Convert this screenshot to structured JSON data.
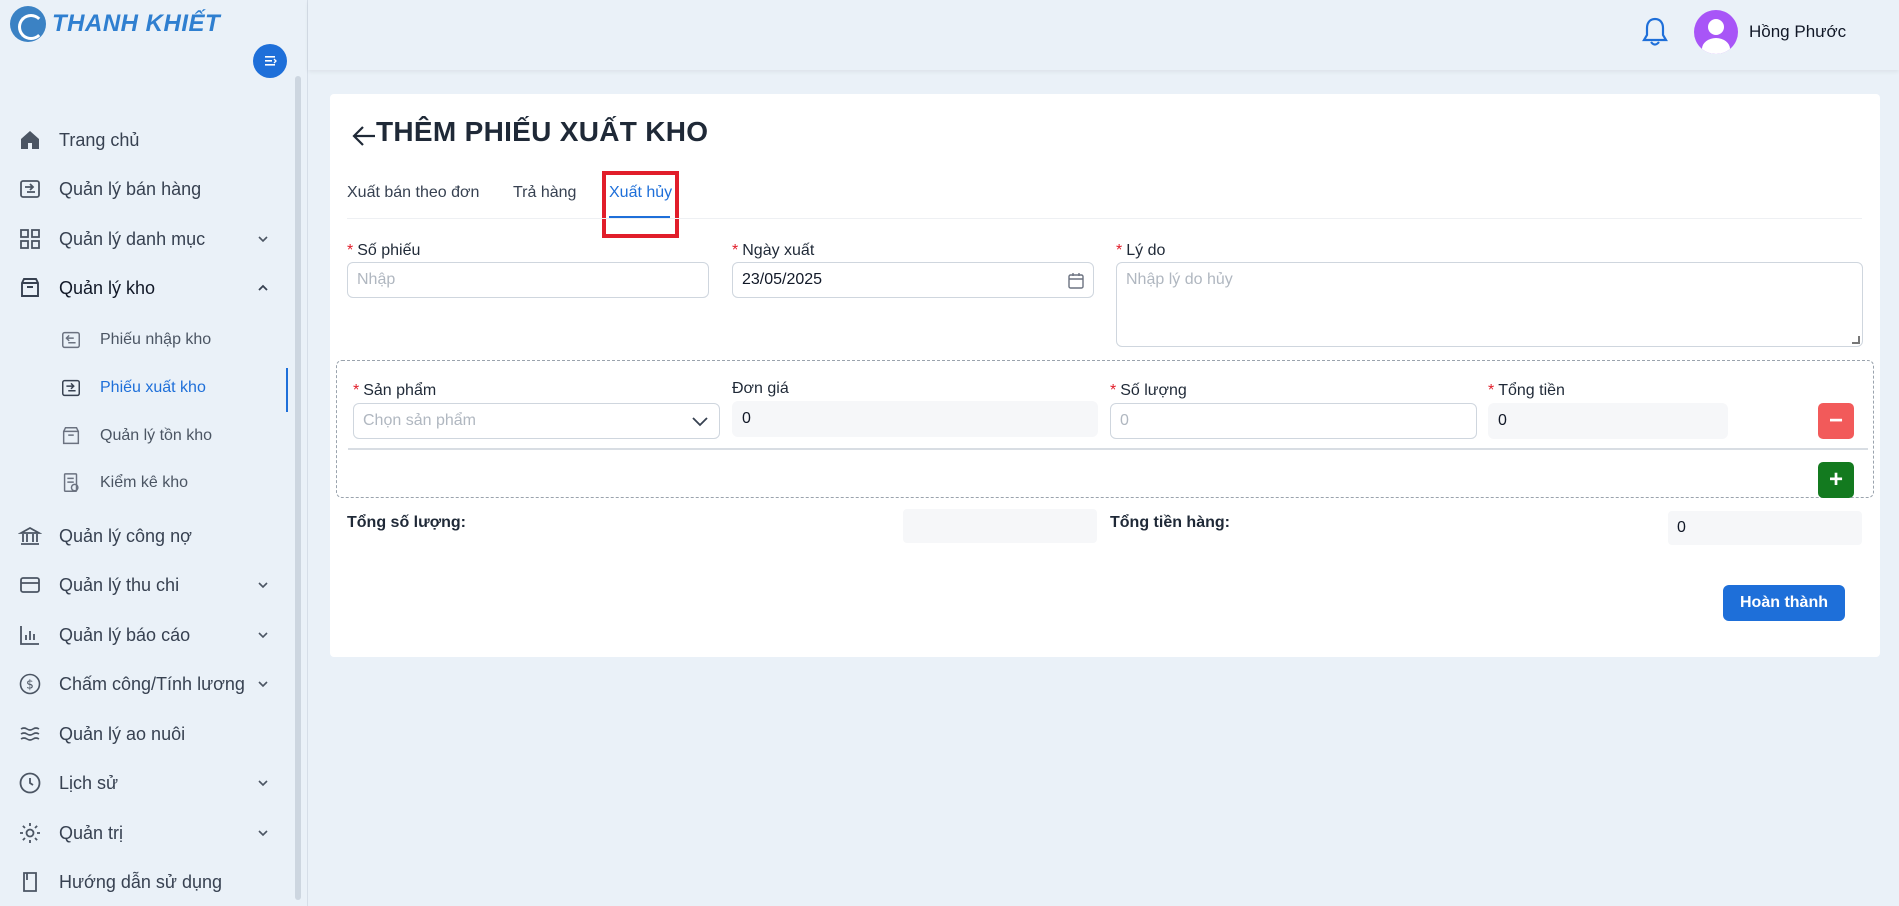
{
  "brand": {
    "name": "THANH KHIẾT"
  },
  "user": {
    "name": "Hồng Phước"
  },
  "sidebar": {
    "items": [
      {
        "label": "Trang chủ",
        "icon": "home-icon"
      },
      {
        "label": "Quản lý bán hàng",
        "icon": "sales-icon"
      },
      {
        "label": "Quản lý danh mục",
        "icon": "grid-icon",
        "expandable": true
      },
      {
        "label": "Quản lý kho",
        "icon": "warehouse-icon",
        "expanded": true
      },
      {
        "label": "Quản lý công nợ",
        "icon": "bank-icon"
      },
      {
        "label": "Quản lý thu chi",
        "icon": "wallet-icon",
        "expandable": true
      },
      {
        "label": "Quản lý báo cáo",
        "icon": "chart-icon",
        "expandable": true
      },
      {
        "label": "Chấm công/Tính lương",
        "icon": "dollar-icon",
        "expandable": true
      },
      {
        "label": "Quản lý ao nuôi",
        "icon": "waves-icon"
      },
      {
        "label": "Lịch sử",
        "icon": "clock-icon",
        "expandable": true
      },
      {
        "label": "Quản trị",
        "icon": "gear-icon",
        "expandable": true
      },
      {
        "label": "Hướng dẫn sử dụng",
        "icon": "book-icon"
      }
    ],
    "sub_items": [
      {
        "label": "Phiếu nhập kho",
        "icon": "import-icon"
      },
      {
        "label": "Phiếu xuất kho",
        "icon": "export-icon",
        "active": true
      },
      {
        "label": "Quản lý tồn kho",
        "icon": "box-icon"
      },
      {
        "label": "Kiểm kê kho",
        "icon": "checklist-icon"
      }
    ]
  },
  "page": {
    "title": "THÊM PHIẾU XUẤT KHO",
    "tabs": [
      {
        "label": "Xuất bán theo đơn"
      },
      {
        "label": "Trả hàng"
      },
      {
        "label": "Xuất hủy",
        "active": true
      }
    ],
    "form": {
      "so_phieu": {
        "label": "Số phiếu",
        "placeholder": "Nhập"
      },
      "ngay_xuat": {
        "label": "Ngày xuất",
        "value": "23/05/2025"
      },
      "ly_do": {
        "label": "Lý do",
        "placeholder": "Nhập lý do hủy"
      },
      "req_mark": "*"
    },
    "product_row": {
      "san_pham": {
        "label": "Sản phẩm",
        "placeholder": "Chọn sản phẩm"
      },
      "don_gia": {
        "label": "Đơn giá",
        "value": "0"
      },
      "so_luong": {
        "label": "Số lượng",
        "placeholder": "0"
      },
      "tong_tien": {
        "label": "Tổng tiền",
        "value": "0"
      },
      "remove_label": "−",
      "add_label": "+"
    },
    "totals": {
      "tong_so_luong_label": "Tổng số lượng:",
      "tong_so_luong_value": "",
      "tong_tien_hang_label": "Tổng tiền hàng:",
      "tong_tien_hang_value": "0"
    },
    "submit_label": "Hoàn thành"
  },
  "colors": {
    "primary": "#1e6fd9",
    "danger": "#f25a5a",
    "success": "#137a1f",
    "highlight": "#e11d2a"
  }
}
